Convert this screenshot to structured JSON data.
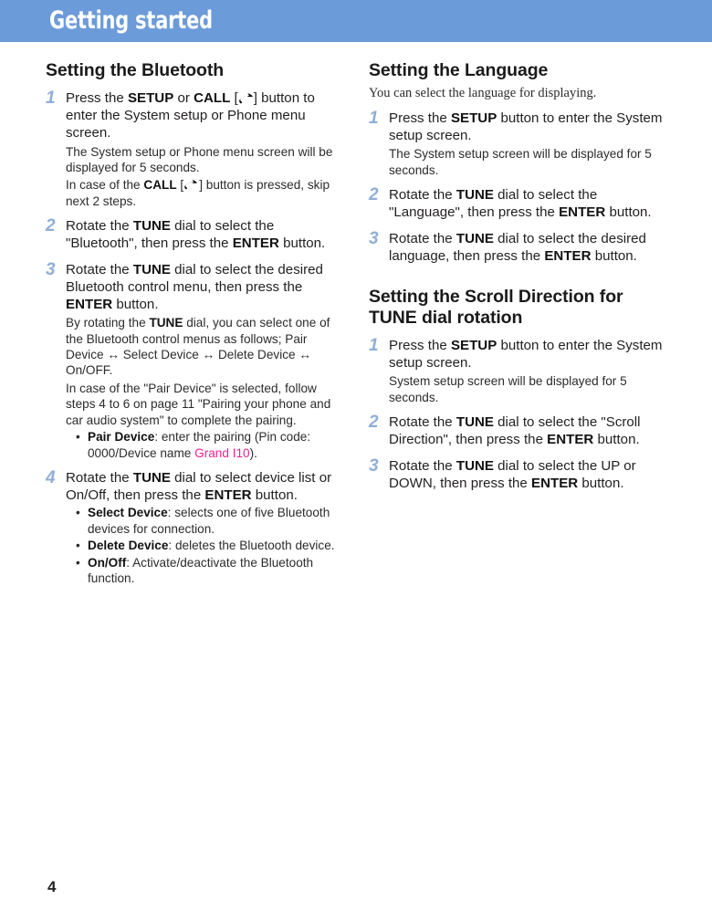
{
  "header": {
    "title": "Getting started",
    "bar_color": "#6c9bd9"
  },
  "footer": {
    "page_number": "4"
  },
  "colors": {
    "step_number": "#8faed8",
    "highlight": "#ea2390",
    "header_bar": "#6c9bd9",
    "text": "#221f1f"
  },
  "left_column": {
    "section": {
      "heading": "Setting the Bluetooth",
      "steps": [
        {
          "number": "1",
          "text_before_icon": "Press the ",
          "bold_1": "SETUP",
          "mid_1": " or ",
          "bold_2": "CALL",
          "bracket_open": " [",
          "icon": "phone-handset-icon",
          "bracket_close": "]",
          "text_after_icon": " button to enter the System setup or Phone menu screen.",
          "notes": [
            {
              "text": "The System setup or Phone menu screen will be displayed for 5 seconds."
            },
            {
              "pre": "In case of the ",
              "bold": "CALL",
              "bracket_open": " [",
              "icon": "phone-handset-icon",
              "bracket_close": "]",
              "post": " button is pressed, skip next 2 steps."
            }
          ]
        },
        {
          "number": "2",
          "pre": "Rotate the ",
          "bold_1": "TUNE",
          "mid": " dial to select the \"Bluetooth\", then press the ",
          "bold_2": "ENTER",
          "post": " button."
        },
        {
          "number": "3",
          "pre": "Rotate the ",
          "bold_1": "TUNE",
          "mid": " dial to select the desired Bluetooth control menu, then press the ",
          "bold_2": "ENTER",
          "post": " button.",
          "notes": [
            {
              "pre": "By rotating the ",
              "bold": "TUNE",
              "post": " dial, you can select one of the Bluetooth control menus as follows; Pair Device ↔ Select Device ↔ Delete Device ↔ On/OFF."
            },
            {
              "text": "In case of the \"Pair Device\" is selected, follow steps 4 to 6 on page 11 \"Pairing your phone and car audio system\" to complete the pairing."
            }
          ],
          "bullets": [
            {
              "label": "Pair Device",
              "text_before_highlight": ": enter the pairing (Pin code: 0000/Device name ",
              "highlight": "Grand I10",
              "text_after_highlight": ")."
            }
          ]
        },
        {
          "number": "4",
          "pre": "Rotate the ",
          "bold_1": "TUNE",
          "mid": " dial to select device list or On/Off, then press the ",
          "bold_2": "ENTER",
          "post": " button.",
          "bullets": [
            {
              "label": "Select Device",
              "text": ": selects one of five Bluetooth devices for connection."
            },
            {
              "label": "Delete Device",
              "text": ": deletes the Bluetooth device."
            },
            {
              "label": "On/Off",
              "text": ": Activate/deactivate the Bluetooth function."
            }
          ]
        }
      ]
    }
  },
  "right_column": {
    "section_language": {
      "heading": "Setting the Language",
      "intro": "You can select the language for displaying.",
      "steps": [
        {
          "number": "1",
          "pre": "Press the ",
          "bold_1": "SETUP",
          "post": " button to enter the System setup screen.",
          "notes": [
            {
              "text": "The System setup screen will be displayed for 5 seconds."
            }
          ]
        },
        {
          "number": "2",
          "pre": "Rotate the ",
          "bold_1": "TUNE",
          "mid": " dial to select the \"Language\", then press the ",
          "bold_2": "ENTER",
          "post": " button."
        },
        {
          "number": "3",
          "pre": "Rotate the ",
          "bold_1": "TUNE",
          "mid": " dial to select the desired language, then press the ",
          "bold_2": "ENTER",
          "post": " button."
        }
      ]
    },
    "section_scroll": {
      "heading": "Setting the Scroll Direction for TUNE dial rotation",
      "steps": [
        {
          "number": "1",
          "pre": "Press the ",
          "bold_1": "SETUP",
          "post": " button to enter the System setup screen.",
          "notes": [
            {
              "text": "System setup screen will be displayed for 5 seconds."
            }
          ]
        },
        {
          "number": "2",
          "pre": "Rotate the ",
          "bold_1": "TUNE",
          "mid": " dial to select the \"Scroll Direction\", then press the ",
          "bold_2": "ENTER",
          "post": " button."
        },
        {
          "number": "3",
          "pre": "Rotate the ",
          "bold_1": "TUNE",
          "mid": " dial to select the UP or DOWN, then press the ",
          "bold_2": "ENTER",
          "post": " button."
        }
      ]
    }
  }
}
